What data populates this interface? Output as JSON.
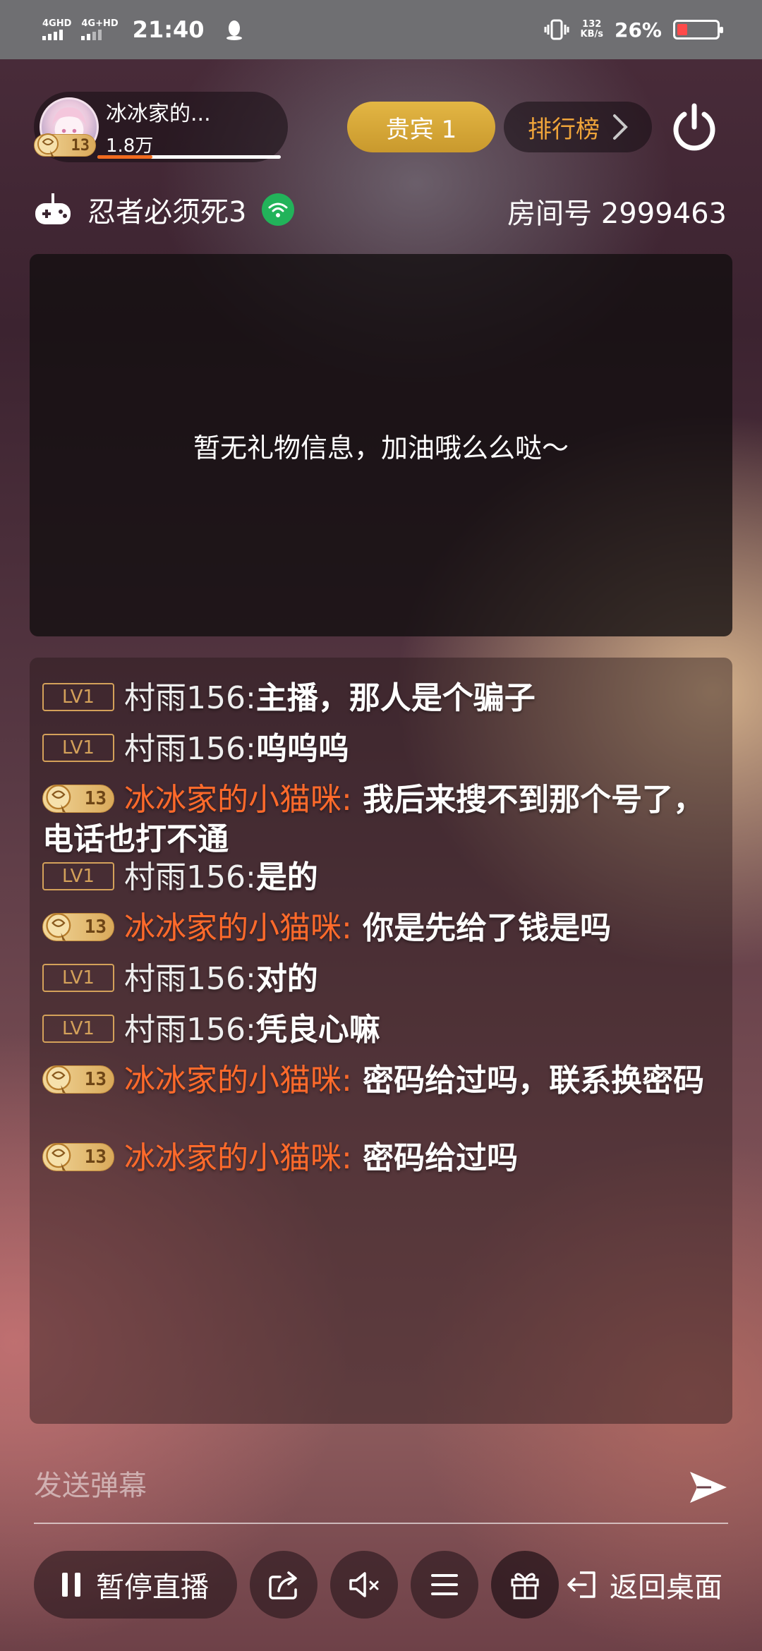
{
  "status_bar": {
    "sim1": "4GHD",
    "sim2": "4G+HD",
    "time": "21:40",
    "net_speed_value": "132",
    "net_speed_unit": "KB/s",
    "battery_percent": "26%",
    "battery_level": 0.26,
    "battery_color": "#ff4a4a"
  },
  "anchor": {
    "name": "冰冰家的...",
    "fans": "1.8万",
    "level": "13",
    "fans_progress": 0.3
  },
  "header": {
    "vip_label": "贵宾 1",
    "rank_label": "排行榜",
    "game_title": "忍者必须死3",
    "room_number": "房间号 2999463"
  },
  "gift_panel": {
    "empty_text": "暂无礼物信息，加油哦么么哒～"
  },
  "chat": {
    "messages": [
      {
        "badge": "LV1",
        "user": "村雨156:",
        "text": "主播，那人是个骗子"
      },
      {
        "badge": "LV1",
        "user": "村雨156:",
        "text": "呜呜呜"
      },
      {
        "badge": "13",
        "user": "冰冰家的小猫咪:",
        "text": " 我后来搜不到那个号了，电话也打不通"
      },
      {
        "badge": "LV1",
        "user": "村雨156:",
        "text": "是的"
      },
      {
        "badge": "13",
        "user": "冰冰家的小猫咪:",
        "text": " 你是先给了钱是吗"
      },
      {
        "badge": "LV1",
        "user": "村雨156:",
        "text": "对的"
      },
      {
        "badge": "LV1",
        "user": "村雨156:",
        "text": "凭良心嘛"
      },
      {
        "badge": "13",
        "user": "冰冰家的小猫咪:",
        "text": " 密码给过吗，联系换密码"
      },
      {
        "badge": "13",
        "user": "冰冰家的小猫咪:",
        "text": " 密码给过吗"
      }
    ]
  },
  "input": {
    "placeholder": "发送弹幕"
  },
  "bottom_bar": {
    "pause_label": "暂停直播",
    "back_label": "返回桌面"
  },
  "colors": {
    "vip_gold": "#e3b644",
    "rank_orange": "#f0a53a",
    "username_orange": "#ff6a2b",
    "level_tag": "#d4a15a",
    "live_green": "#22b35a"
  },
  "icons": [
    "qq-penguin-icon",
    "vibrate-icon",
    "battery-icon",
    "power-icon",
    "gamepad-icon",
    "wifi-icon",
    "chevron-right-icon",
    "send-icon",
    "pause-icon",
    "share-icon",
    "mute-icon",
    "menu-icon",
    "gift-icon",
    "exit-icon",
    "medal-icon"
  ]
}
